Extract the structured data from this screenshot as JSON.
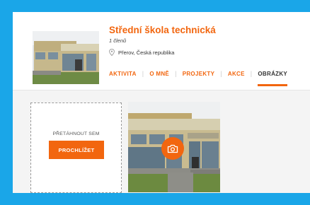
{
  "profile": {
    "name": "Střední škola technická",
    "members": "1 členů",
    "location": "Přerov, Česká republika"
  },
  "tabs": [
    {
      "label": "AKTIVITA",
      "active": false
    },
    {
      "label": "O MNĚ",
      "active": false
    },
    {
      "label": "PROJEKTY",
      "active": false
    },
    {
      "label": "AKCE",
      "active": false
    },
    {
      "label": "OBRÁZKY",
      "active": true
    }
  ],
  "upload": {
    "drop_label": "PŘETÁHNOUT SEM",
    "browse_label": "PROCHLÍŽET"
  },
  "icons": {
    "location": "location-pin-icon",
    "camera": "camera-icon"
  },
  "colors": {
    "accent": "#f2660f",
    "background": "#1aa6e8"
  }
}
